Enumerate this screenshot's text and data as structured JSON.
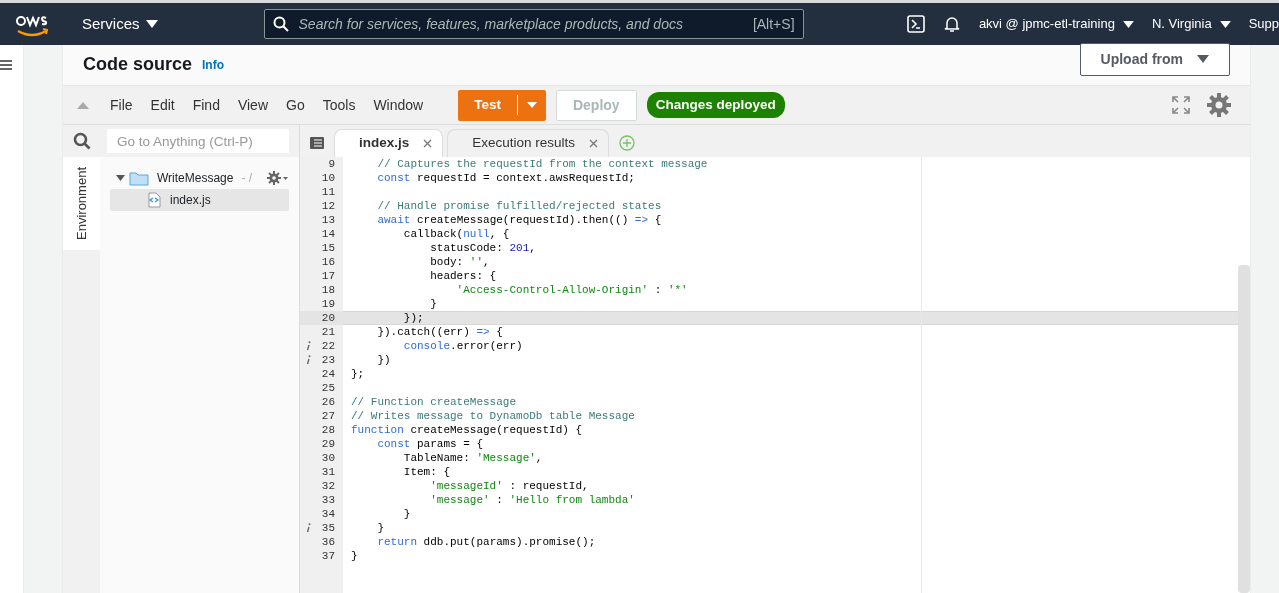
{
  "navbar": {
    "services": "Services",
    "search_placeholder": "Search for services, features, marketplace products, and docs",
    "search_shortcut": "[Alt+S]",
    "account": "akvi @ jpmc-etl-training",
    "region": "N. Virginia",
    "support": "Supp"
  },
  "header": {
    "title": "Code source",
    "info": "Info",
    "upload": "Upload from"
  },
  "menu": [
    "File",
    "Edit",
    "Find",
    "View",
    "Go",
    "Tools",
    "Window"
  ],
  "toolbar": {
    "test": "Test",
    "deploy": {
      "label": "Deploy",
      "disabled": true
    },
    "status": "Changes deployed"
  },
  "sidebar": {
    "search_placeholder": "Go to Anything (Ctrl-P)",
    "panel_tab": "Environment",
    "tree": [
      {
        "label": "WriteMessage",
        "suffix": "- /",
        "expanded": true,
        "children": [
          {
            "label": "index.js",
            "selected": true
          }
        ]
      }
    ]
  },
  "tabs": [
    {
      "label": "index.js",
      "selected": true
    },
    {
      "label": "Execution results",
      "selected": false
    }
  ],
  "code": [
    {
      "num": "9",
      "current": false,
      "annotation": false,
      "tokens": [
        {
          "kind": "comment",
          "text": "    // Captures the requestId from the context message"
        }
      ]
    },
    {
      "num": "10",
      "current": false,
      "annotation": false,
      "tokens": [
        {
          "kind": "keyword",
          "text": "    const"
        },
        {
          "kind": "plain",
          "text": " requestId = context.awsRequestId;"
        }
      ]
    },
    {
      "num": "11",
      "current": false,
      "annotation": false
    },
    {
      "num": "12",
      "current": false,
      "annotation": false,
      "tokens": [
        {
          "kind": "comment",
          "text": "    // Handle promise fulfilled/rejected states"
        }
      ]
    },
    {
      "num": "13",
      "current": false,
      "annotation": false,
      "tokens": [
        {
          "kind": "keyword",
          "text": "    await"
        },
        {
          "kind": "plain",
          "text": " createMessage(requestId).then(() "
        },
        {
          "kind": "keyword",
          "text": "=>"
        },
        {
          "kind": "plain",
          "text": " {"
        }
      ]
    },
    {
      "num": "14",
      "current": false,
      "annotation": false,
      "tokens": [
        {
          "kind": "plain",
          "text": "        callback("
        },
        {
          "kind": "keyword",
          "text": "null"
        },
        {
          "kind": "plain",
          "text": ", {"
        }
      ]
    },
    {
      "num": "15",
      "current": false,
      "annotation": false,
      "tokens": [
        {
          "kind": "plain",
          "text": "            statusCode: "
        },
        {
          "kind": "number",
          "text": "201"
        },
        {
          "kind": "plain",
          "text": ","
        }
      ]
    },
    {
      "num": "16",
      "current": false,
      "annotation": false,
      "tokens": [
        {
          "kind": "plain",
          "text": "            body: "
        },
        {
          "kind": "string",
          "text": "''"
        },
        {
          "kind": "plain",
          "text": ","
        }
      ]
    },
    {
      "num": "17",
      "current": false,
      "annotation": false,
      "tokens": [
        {
          "kind": "plain",
          "text": "            headers: {"
        }
      ]
    },
    {
      "num": "18",
      "current": false,
      "annotation": false,
      "tokens": [
        {
          "kind": "string",
          "text": "                'Access-Control-Allow-Origin'"
        },
        {
          "kind": "plain",
          "text": " : "
        },
        {
          "kind": "string",
          "text": "'*'"
        }
      ]
    },
    {
      "num": "19",
      "current": false,
      "annotation": false,
      "tokens": [
        {
          "kind": "plain",
          "text": "            }"
        }
      ]
    },
    {
      "num": "20",
      "current": true,
      "annotation": false,
      "tokens": [
        {
          "kind": "plain",
          "text": "        });"
        }
      ]
    },
    {
      "num": "21",
      "current": false,
      "annotation": false,
      "tokens": [
        {
          "kind": "plain",
          "text": "    }).catch((err) "
        },
        {
          "kind": "keyword",
          "text": "=>"
        },
        {
          "kind": "plain",
          "text": " {"
        }
      ]
    },
    {
      "num": "22",
      "current": false,
      "annotation": true,
      "tokens": [
        {
          "kind": "keyword",
          "text": "        console"
        },
        {
          "kind": "plain",
          "text": ".error(err)"
        }
      ]
    },
    {
      "num": "23",
      "current": false,
      "annotation": true,
      "tokens": [
        {
          "kind": "plain",
          "text": "    })"
        }
      ]
    },
    {
      "num": "24",
      "current": false,
      "annotation": false,
      "tokens": [
        {
          "kind": "plain",
          "text": "};"
        }
      ]
    },
    {
      "num": "25",
      "current": false,
      "annotation": false
    },
    {
      "num": "26",
      "current": false,
      "annotation": false,
      "tokens": [
        {
          "kind": "comment",
          "text": "// Function createMessage"
        }
      ]
    },
    {
      "num": "27",
      "current": false,
      "annotation": false,
      "tokens": [
        {
          "kind": "comment",
          "text": "// Writes message to DynamoDb table Message"
        }
      ]
    },
    {
      "num": "28",
      "current": false,
      "annotation": false,
      "tokens": [
        {
          "kind": "keyword",
          "text": "function"
        },
        {
          "kind": "plain",
          "text": " createMessage(requestId) {"
        }
      ]
    },
    {
      "num": "29",
      "current": false,
      "annotation": false,
      "tokens": [
        {
          "kind": "keyword",
          "text": "    const"
        },
        {
          "kind": "plain",
          "text": " params = {"
        }
      ]
    },
    {
      "num": "30",
      "current": false,
      "annotation": false,
      "tokens": [
        {
          "kind": "plain",
          "text": "        TableName: "
        },
        {
          "kind": "string",
          "text": "'Message'"
        },
        {
          "kind": "plain",
          "text": ","
        }
      ]
    },
    {
      "num": "31",
      "current": false,
      "annotation": false,
      "tokens": [
        {
          "kind": "plain",
          "text": "        Item: {"
        }
      ]
    },
    {
      "num": "32",
      "current": false,
      "annotation": false,
      "tokens": [
        {
          "kind": "string",
          "text": "            'messageId'"
        },
        {
          "kind": "plain",
          "text": " : requestId,"
        }
      ]
    },
    {
      "num": "33",
      "current": false,
      "annotation": false,
      "tokens": [
        {
          "kind": "string",
          "text": "            'message'"
        },
        {
          "kind": "plain",
          "text": " : "
        },
        {
          "kind": "string",
          "text": "'Hello from lambda'"
        }
      ]
    },
    {
      "num": "34",
      "current": false,
      "annotation": false,
      "tokens": [
        {
          "kind": "plain",
          "text": "        }"
        }
      ]
    },
    {
      "num": "35",
      "current": false,
      "annotation": true,
      "tokens": [
        {
          "kind": "plain",
          "text": "    }"
        }
      ]
    },
    {
      "num": "36",
      "current": false,
      "annotation": false,
      "tokens": [
        {
          "kind": "keyword",
          "text": "    return"
        },
        {
          "kind": "plain",
          "text": " ddb.put(params).promise();"
        }
      ]
    },
    {
      "num": "37",
      "current": false,
      "annotation": false,
      "tokens": [
        {
          "kind": "plain",
          "text": "}"
        }
      ]
    }
  ]
}
